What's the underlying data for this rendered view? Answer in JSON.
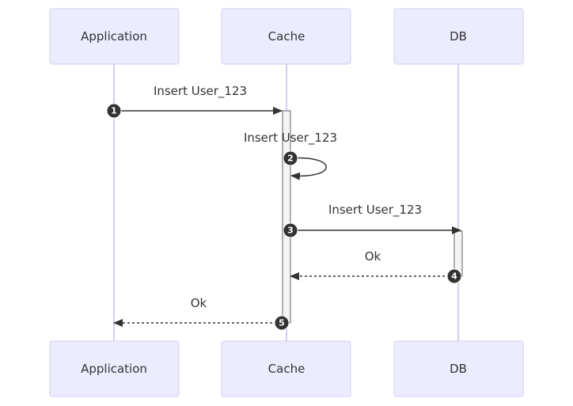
{
  "diagram": {
    "type": "sequence",
    "participants": [
      {
        "id": "app",
        "label": "Application"
      },
      {
        "id": "cache",
        "label": "Cache"
      },
      {
        "id": "db",
        "label": "DB"
      }
    ],
    "messages": [
      {
        "seq": "1",
        "from": "app",
        "to": "cache",
        "label": "Insert User_123",
        "style": "solid"
      },
      {
        "seq": "2",
        "from": "cache",
        "to": "cache",
        "label": "Insert User_123",
        "style": "solid"
      },
      {
        "seq": "3",
        "from": "cache",
        "to": "db",
        "label": "Insert User_123",
        "style": "solid"
      },
      {
        "seq": "4",
        "from": "db",
        "to": "cache",
        "label": "Ok",
        "style": "dashed"
      },
      {
        "seq": "5",
        "from": "cache",
        "to": "app",
        "label": "Ok",
        "style": "dashed"
      }
    ],
    "activations": [
      {
        "participant": "cache",
        "from_message": "1",
        "to_message": "5"
      },
      {
        "participant": "db",
        "from_message": "3",
        "to_message": "4"
      }
    ],
    "colors": {
      "actor_fill": "#ECECFF",
      "actor_border": "#d6ccf4",
      "lifeline": "#d6ccf4",
      "line": "#333333",
      "activation_fill": "#f4f4f4"
    }
  }
}
